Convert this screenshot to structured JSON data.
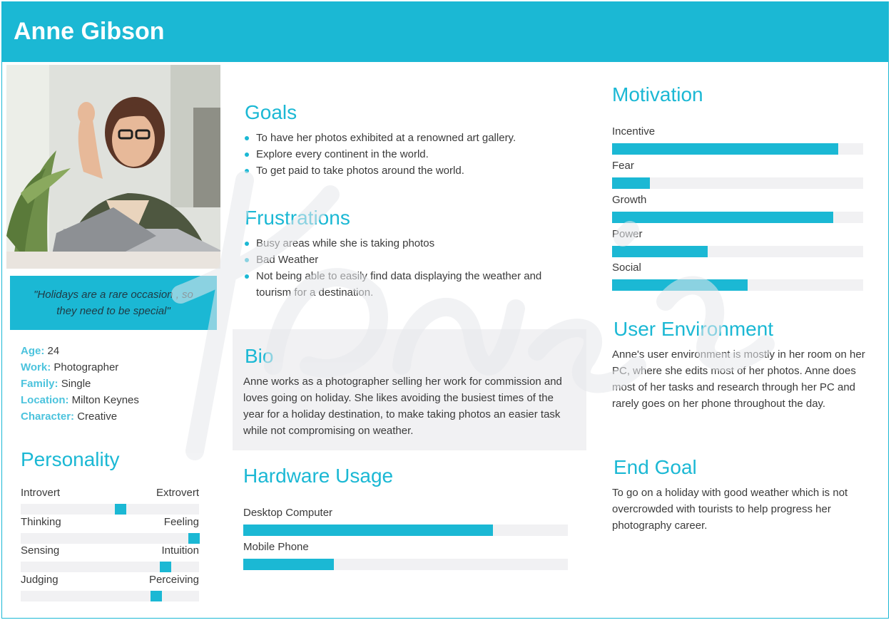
{
  "header": {
    "name": "Anne Gibson"
  },
  "quote": "\"Holidays are a rare occasion , so they need to be special\"",
  "facts": [
    {
      "label": "Age:",
      "value": "24"
    },
    {
      "label": "Work:",
      "value": "Photographer"
    },
    {
      "label": "Family:",
      "value": "Single"
    },
    {
      "label": "Location:",
      "value": "Milton Keynes"
    },
    {
      "label": "Character:",
      "value": "Creative"
    }
  ],
  "personality": {
    "title": "Personality",
    "scales": [
      {
        "left": "Introvert",
        "right": "Extrovert",
        "position": 0.56
      },
      {
        "left": "Thinking",
        "right": "Feeling",
        "position": 0.97
      },
      {
        "left": "Sensing",
        "right": "Intuition",
        "position": 0.81
      },
      {
        "left": "Judging",
        "right": "Perceiving",
        "position": 0.76
      }
    ]
  },
  "goals": {
    "title": "Goals",
    "items": [
      "To have her photos exhibited at a renowned art gallery.",
      "Explore every continent in the world.",
      "To get paid to take photos around the world."
    ]
  },
  "frustrations": {
    "title": "Frustrations",
    "items": [
      "Busy areas while she is taking photos",
      "Bad Weather",
      "Not being able to easily find data displaying the weather and tourism for a destination."
    ]
  },
  "bio": {
    "title": "Bio",
    "text": "Anne works as a photographer selling her work for commission and loves going on holiday. She likes avoiding the busiest times of the year for a holiday destination, to make taking photos an easier task while not compromising on weather."
  },
  "hardware": {
    "title": "Hardware Usage",
    "items": [
      {
        "label": "Desktop Computer",
        "value": 0.77
      },
      {
        "label": "Mobile Phone",
        "value": 0.28
      }
    ]
  },
  "motivation": {
    "title": "Motivation",
    "items": [
      {
        "label": "Incentive",
        "value": 0.9
      },
      {
        "label": "Fear",
        "value": 0.15
      },
      {
        "label": "Growth",
        "value": 0.88
      },
      {
        "label": "Power",
        "value": 0.38
      },
      {
        "label": "Social",
        "value": 0.54
      }
    ]
  },
  "user_environment": {
    "title": "User Environment",
    "text": "Anne's user environment is mostly in her room on her PC, where she edits most of her photos. Anne does most of her tasks and research through her PC and rarely goes on her phone throughout the day."
  },
  "end_goal": {
    "title": "End Goal",
    "text": "To go on a holiday with good weather which is not overcrowded with tourists to help progress her photography career."
  },
  "colors": {
    "accent": "#1bb8d4",
    "track": "#f1f1f3",
    "label_accent": "#4cc3dd"
  }
}
